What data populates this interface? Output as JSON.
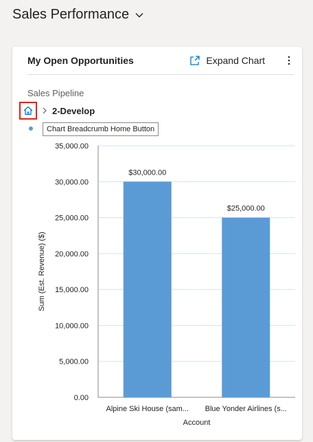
{
  "header": {
    "title": "Sales Performance"
  },
  "card": {
    "title": "My Open Opportunities",
    "expand_label": "Expand Chart",
    "chart_name": "Sales Pipeline",
    "breadcrumb_label": "2-Develop",
    "tooltip": "Chart Breadcrumb Home Button"
  },
  "chart_data": {
    "type": "bar",
    "categories": [
      "Alpine Ski House (sam...",
      "Blue Yonder Airlines (s..."
    ],
    "values": [
      30000,
      25000
    ],
    "data_labels": [
      "$30,000.00",
      "$25,000.00"
    ],
    "xlabel": "Account",
    "ylabel": "Sum (Est. Revenue) ($)",
    "ylim": [
      0,
      35000
    ],
    "yticks": [
      "0.00",
      "5,000.00",
      "10,000.00",
      "15,000.00",
      "20,000.00",
      "25,000.00",
      "30,000.00",
      "35,000.00"
    ],
    "ytick_values": [
      0,
      5000,
      10000,
      15000,
      20000,
      25000,
      30000,
      35000
    ],
    "grid": true,
    "bar_color": "#5b9bd5"
  }
}
